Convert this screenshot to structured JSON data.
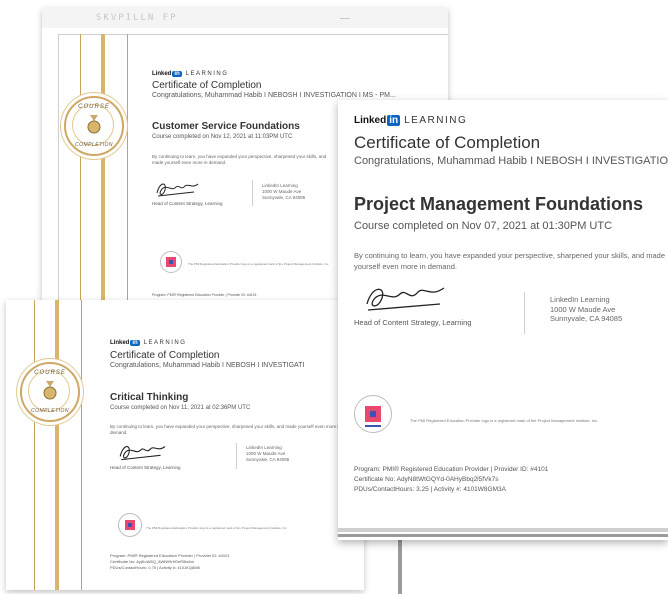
{
  "linkedin": {
    "wordmark": "Linked",
    "in": "in",
    "learning": "LEARNING"
  },
  "cert1": {
    "header_brand": "SKVPILLN FP",
    "title": "Certificate of Completion",
    "congrats": "Congratulations, Muhammad Habib I NEBOSH I INVESTIGATION I MS - PM...",
    "course": "Customer Service Foundations",
    "date": "Course completed on Nov 12, 2021 at 11:03PM UTC",
    "body": "By continuing to learn, you have expanded your perspective, sharpened your skills, and made yourself even more in demand.",
    "sign_role": "Head of Content Strategy, Learning",
    "address": "LinkedIn Learning\n1000 W Maude Ave\nSunnyvale, CA 94085",
    "pmi_line": "The PMI Registered Education Provider logo is a registered mark of the Project Management Institute, Inc.",
    "footer": "Program: PMI® Registered Education Provider | Provider ID: #4101",
    "seal_top": "COURSE",
    "seal_bottom": "COMPLETION"
  },
  "cert2": {
    "title": "Certificate of Completion",
    "congrats": "Congratulations, Muhammad Habib I NEBOSH I INVESTIGATI",
    "course": "Critical Thinking",
    "date": "Course completed on Nov 11, 2021 at 02:36PM UTC",
    "body": "By continuing to learn, you have expanded your perspective, sharpened your skills, and made yourself even more in demand.",
    "sign_role": "Head of Content Strategy, Learning",
    "address": "LinkedIn Learning\n1000 W Maude Ave\nSunnyvale, CA 94085",
    "pmi_line": "The PMI Registered Education Provider logo is a registered mark of the Project Management Institute, Inc.",
    "footer": "Program: PMI® Registered Education Provider | Provider ID: #4101\nCertificate No: AyjKoW8Q_AWfW9r9GeR5tx6m\nPDUs/ContactHours: 0.75 | Activity #: 4101KQ8M8",
    "seal_top": "COURSE",
    "seal_bottom": "COMPLETION"
  },
  "cert3": {
    "title": "Certificate of Completion",
    "congrats": "Congratulations, Muhammad Habib I NEBOSH I INVESTIGATION",
    "course": "Project Management Foundations",
    "date": "Course completed on Nov 07, 2021 at 01:30PM UTC",
    "body": "By continuing to learn, you have expanded your perspective, sharpened your skills, and made yourself even more in demand.",
    "sign_role": "Head of Content Strategy, Learning",
    "address": "LinkedIn Learning\n1000 W Maude Ave\nSunnyvale, CA 94085",
    "pmi_line": "The PMI Registered Education Provider logo is a registered mark of the Project Management Institute, Inc.",
    "footer": "Program: PMI® Registered Education Provider | Provider ID: #4101\nCertificate No: AdyN8tWtGQYd-0AHyBbq2l5fVk7s\nPDUs/ContactHours: 3.25 | Activity #: 4101W8GM3A"
  },
  "colors": {
    "linkedin_blue": "#0a66c2",
    "gold": "#d8b56c",
    "text_dark": "#333333"
  },
  "icons": {
    "seal": "course-completion-seal-icon",
    "pmi": "pmi-logo-icon"
  }
}
